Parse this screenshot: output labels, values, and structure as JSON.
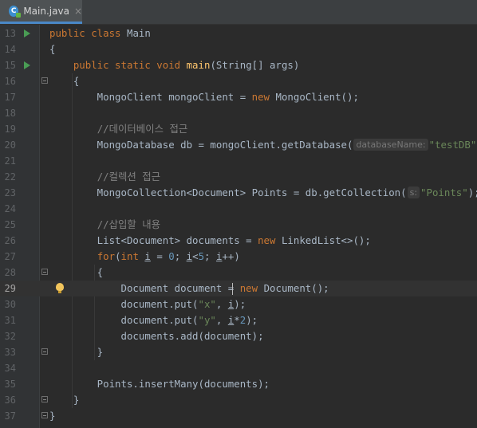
{
  "tab": {
    "icon": "java-class-icon",
    "label": "Main.java",
    "close": "×"
  },
  "colors": {
    "keyword": "#cc7832",
    "method": "#ffc66d",
    "string": "#6a8759",
    "number": "#6897bb",
    "comment": "#808080",
    "text": "#a9b7c6",
    "run_icon": "#499c54"
  },
  "editor": {
    "current_line": 29,
    "lines": [
      {
        "n": "13",
        "run": true,
        "fold": false,
        "bulb": false,
        "tokens": [
          [
            "kw",
            "public class "
          ],
          [
            "p",
            "Main"
          ]
        ]
      },
      {
        "n": "14",
        "run": false,
        "fold": false,
        "bulb": false,
        "tokens": [
          [
            "p",
            "{"
          ]
        ]
      },
      {
        "n": "15",
        "run": true,
        "fold": false,
        "bulb": false,
        "tokens": [
          [
            "p",
            "    "
          ],
          [
            "kw",
            "public static void "
          ],
          [
            "fn",
            "main"
          ],
          [
            "p",
            "(String[] args)"
          ]
        ]
      },
      {
        "n": "16",
        "run": false,
        "fold": true,
        "bulb": false,
        "tokens": [
          [
            "p",
            "    {"
          ]
        ]
      },
      {
        "n": "17",
        "run": false,
        "fold": false,
        "bulb": false,
        "tokens": [
          [
            "p",
            "        MongoClient mongoClient = "
          ],
          [
            "kw",
            "new "
          ],
          [
            "p",
            "MongoClient();"
          ]
        ]
      },
      {
        "n": "18",
        "run": false,
        "fold": false,
        "bulb": false,
        "tokens": []
      },
      {
        "n": "19",
        "run": false,
        "fold": false,
        "bulb": false,
        "tokens": [
          [
            "p",
            "        "
          ],
          [
            "cm",
            "//데이터베이스 접근"
          ]
        ]
      },
      {
        "n": "20",
        "run": false,
        "fold": false,
        "bulb": false,
        "tokens": [
          [
            "p",
            "        MongoDatabase db = mongoClient.getDatabase("
          ],
          [
            "hint",
            "databaseName:"
          ],
          [
            "str",
            "\"testDB\""
          ],
          [
            "p",
            ");"
          ]
        ]
      },
      {
        "n": "21",
        "run": false,
        "fold": false,
        "bulb": false,
        "tokens": []
      },
      {
        "n": "22",
        "run": false,
        "fold": false,
        "bulb": false,
        "tokens": [
          [
            "p",
            "        "
          ],
          [
            "cm",
            "//컬렉션 접근"
          ]
        ]
      },
      {
        "n": "23",
        "run": false,
        "fold": false,
        "bulb": false,
        "tokens": [
          [
            "p",
            "        MongoCollection<Document> Points = db.getCollection("
          ],
          [
            "hint",
            "s:"
          ],
          [
            "str",
            "\"Points\""
          ],
          [
            "p",
            ");"
          ]
        ]
      },
      {
        "n": "24",
        "run": false,
        "fold": false,
        "bulb": false,
        "tokens": []
      },
      {
        "n": "25",
        "run": false,
        "fold": false,
        "bulb": false,
        "tokens": [
          [
            "p",
            "        "
          ],
          [
            "cm",
            "//삽입할 내용"
          ]
        ]
      },
      {
        "n": "26",
        "run": false,
        "fold": false,
        "bulb": false,
        "tokens": [
          [
            "p",
            "        List<Document> documents = "
          ],
          [
            "kw",
            "new "
          ],
          [
            "p",
            "LinkedList<>();"
          ]
        ]
      },
      {
        "n": "27",
        "run": false,
        "fold": false,
        "bulb": false,
        "tokens": [
          [
            "p",
            "        "
          ],
          [
            "kw",
            "for"
          ],
          [
            "p",
            "("
          ],
          [
            "kw",
            "int "
          ],
          [
            "var",
            "i"
          ],
          [
            "p",
            " = "
          ],
          [
            "num",
            "0"
          ],
          [
            "p",
            "; "
          ],
          [
            "var",
            "i"
          ],
          [
            "p",
            "<"
          ],
          [
            "num",
            "5"
          ],
          [
            "p",
            "; "
          ],
          [
            "var",
            "i"
          ],
          [
            "p",
            "++)"
          ]
        ]
      },
      {
        "n": "28",
        "run": false,
        "fold": true,
        "bulb": false,
        "tokens": [
          [
            "p",
            "        {"
          ]
        ]
      },
      {
        "n": "29",
        "run": false,
        "fold": false,
        "bulb": true,
        "tokens": [
          [
            "p",
            "            Document document = "
          ],
          [
            "kw",
            "new "
          ],
          [
            "p",
            "Document();"
          ]
        ]
      },
      {
        "n": "30",
        "run": false,
        "fold": false,
        "bulb": false,
        "tokens": [
          [
            "p",
            "            document.put("
          ],
          [
            "str",
            "\"x\""
          ],
          [
            "p",
            ", "
          ],
          [
            "var",
            "i"
          ],
          [
            "p",
            ");"
          ]
        ]
      },
      {
        "n": "31",
        "run": false,
        "fold": false,
        "bulb": false,
        "tokens": [
          [
            "p",
            "            document.put("
          ],
          [
            "str",
            "\"y\""
          ],
          [
            "p",
            ", "
          ],
          [
            "var",
            "i"
          ],
          [
            "p",
            "*"
          ],
          [
            "num",
            "2"
          ],
          [
            "p",
            ");"
          ]
        ]
      },
      {
        "n": "32",
        "run": false,
        "fold": false,
        "bulb": false,
        "tokens": [
          [
            "p",
            "            documents.add(document);"
          ]
        ]
      },
      {
        "n": "33",
        "run": false,
        "fold": true,
        "bulb": false,
        "tokens": [
          [
            "p",
            "        }"
          ]
        ]
      },
      {
        "n": "34",
        "run": false,
        "fold": false,
        "bulb": false,
        "tokens": []
      },
      {
        "n": "35",
        "run": false,
        "fold": false,
        "bulb": false,
        "tokens": [
          [
            "p",
            "        Points.insertMany(documents);"
          ]
        ]
      },
      {
        "n": "36",
        "run": false,
        "fold": true,
        "bulb": false,
        "tokens": [
          [
            "p",
            "    }"
          ]
        ]
      },
      {
        "n": "37",
        "run": false,
        "fold": true,
        "bulb": false,
        "tokens": [
          [
            "p",
            "}"
          ]
        ]
      }
    ]
  }
}
